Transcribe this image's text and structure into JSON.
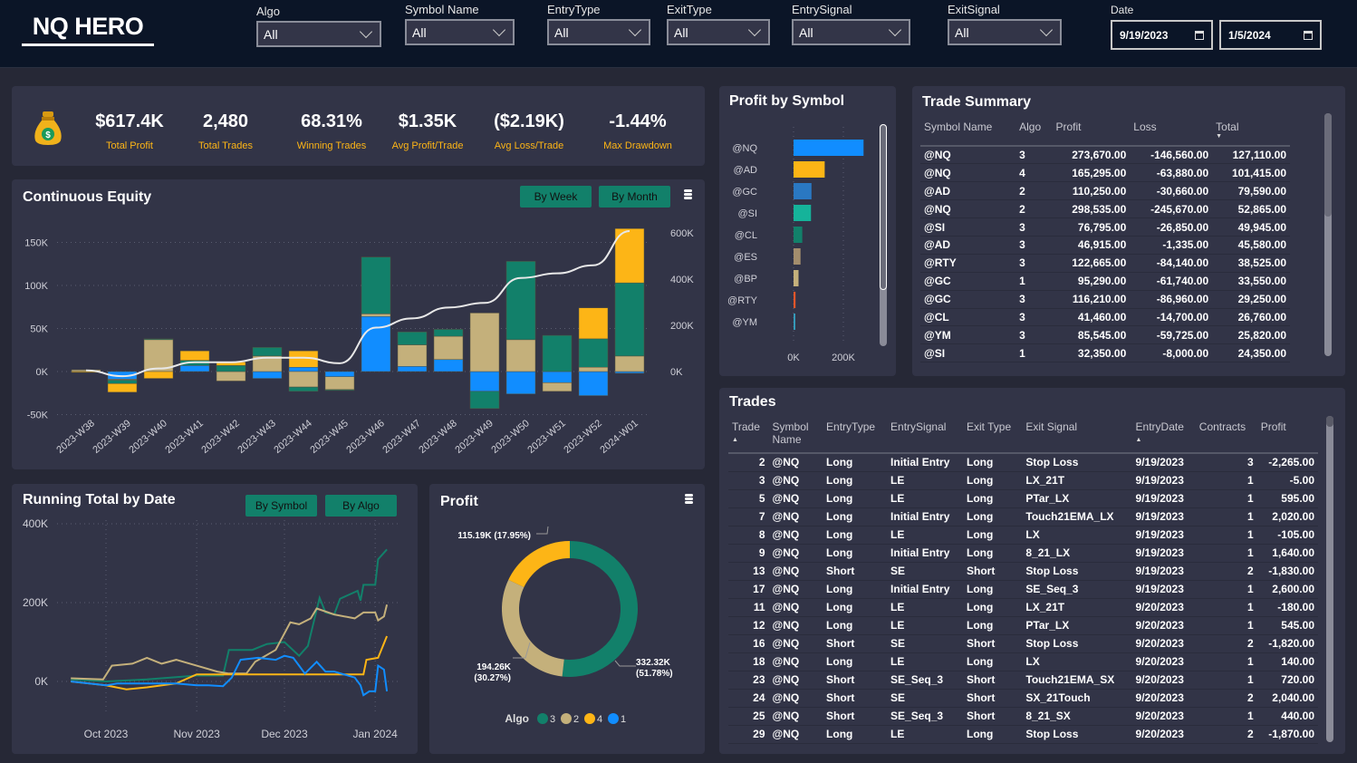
{
  "header": {
    "logo": "NQ HERO",
    "filters": [
      {
        "label": "Algo",
        "value": "All"
      },
      {
        "label": "Symbol Name",
        "value": "All"
      },
      {
        "label": "EntryType",
        "value": "All"
      },
      {
        "label": "ExitType",
        "value": "All"
      },
      {
        "label": "EntrySignal",
        "value": "All"
      },
      {
        "label": "ExitSignal",
        "value": "All"
      }
    ],
    "date": {
      "label": "Date",
      "start": "9/19/2023",
      "end": "1/5/2024"
    }
  },
  "kpis": [
    {
      "value": "$617.4K",
      "label": "Total Profit"
    },
    {
      "value": "2,480",
      "label": "Total Trades"
    },
    {
      "value": "68.31%",
      "label": "Winning Trades"
    },
    {
      "value": "$1.35K",
      "label": "Avg Profit/Trade"
    },
    {
      "value": "($2.19K)",
      "label": "Avg Loss/Trade"
    },
    {
      "value": "-1.44%",
      "label": "Max Drawdown"
    }
  ],
  "colors": {
    "algo1": "#118dff",
    "algo2": "#c4b07b",
    "algo3": "#12806a",
    "algo4": "#fdb516",
    "line": "#e8e8e8"
  },
  "chart_data": [
    {
      "id": "continuous-equity",
      "type": "bar",
      "title": "Continuous Equity",
      "stacked": true,
      "buttons": [
        "By Week",
        "By Month"
      ],
      "categories": [
        "2023-W38",
        "2023-W39",
        "2023-W40",
        "2023-W41",
        "2023-W42",
        "2023-W43",
        "2023-W44",
        "2023-W45",
        "2023-W46",
        "2023-W47",
        "2023-W48",
        "2023-W49",
        "2023-W50",
        "2023-W51",
        "2023-W52",
        "2024-W01"
      ],
      "series": [
        {
          "key": "algo1",
          "values": [
            0,
            -9,
            0,
            7,
            0,
            -8,
            5,
            -6,
            64,
            6,
            14,
            -23,
            -26,
            -13,
            -28,
            -2
          ]
        },
        {
          "key": "algo2",
          "values": [
            2,
            -1,
            37,
            0,
            -11,
            18,
            -18,
            -15,
            3,
            25,
            27,
            68,
            37,
            -10,
            5,
            18
          ]
        },
        {
          "key": "algo3",
          "values": [
            0,
            -4,
            1,
            6,
            7,
            10,
            -5,
            -1,
            66,
            15,
            8,
            -20,
            91,
            42,
            33,
            85
          ]
        },
        {
          "key": "algo4",
          "values": [
            -1,
            -10,
            -8,
            11,
            4,
            0,
            19,
            0,
            0,
            0,
            0,
            0,
            0,
            0,
            36,
            63
          ]
        }
      ],
      "line": {
        "axis": "right",
        "values": [
          5,
          -20,
          13,
          40,
          40,
          60,
          60,
          36,
          190,
          230,
          277,
          297,
          405,
          425,
          460,
          640
        ]
      },
      "ylim": [
        -50,
        150
      ],
      "yticks": [
        "-50K",
        "0K",
        "50K",
        "100K",
        "150K"
      ],
      "y2lim": [
        0,
        600
      ],
      "y2ticks": [
        "0K",
        "200K",
        "400K",
        "600K"
      ],
      "unit": "K"
    },
    {
      "id": "running-total",
      "type": "line",
      "title": "Running Total by Date",
      "buttons": [
        "By Symbol",
        "By Algo"
      ],
      "yticks": [
        "0K",
        "200K",
        "400K"
      ],
      "xticks": [
        "Oct 2023",
        "Nov 2023",
        "Dec 2023",
        "Jan 2024"
      ],
      "series": [
        {
          "key": "algo3",
          "points": [
            [
              "2023-09-19",
              5
            ],
            [
              "2023-10-01",
              0
            ],
            [
              "2023-10-15",
              5
            ],
            [
              "2023-11-01",
              15
            ],
            [
              "2023-11-10",
              15
            ],
            [
              "2023-11-12",
              80
            ],
            [
              "2023-11-20",
              80
            ],
            [
              "2023-11-25",
              95
            ],
            [
              "2023-12-01",
              100
            ],
            [
              "2023-12-06",
              65
            ],
            [
              "2023-12-09",
              90
            ],
            [
              "2023-12-13",
              212
            ],
            [
              "2023-12-15",
              175
            ],
            [
              "2023-12-18",
              170
            ],
            [
              "2023-12-20",
              210
            ],
            [
              "2023-12-26",
              230
            ],
            [
              "2023-12-27",
              205
            ],
            [
              "2023-12-28",
              245
            ],
            [
              "2024-01-01",
              245
            ],
            [
              "2024-01-02",
              310
            ],
            [
              "2024-01-05",
              335
            ]
          ]
        },
        {
          "key": "algo2",
          "points": [
            [
              "2023-09-19",
              8
            ],
            [
              "2023-09-30",
              5
            ],
            [
              "2023-10-03",
              40
            ],
            [
              "2023-10-10",
              45
            ],
            [
              "2023-10-15",
              60
            ],
            [
              "2023-10-20",
              45
            ],
            [
              "2023-10-25",
              55
            ],
            [
              "2023-11-01",
              40
            ],
            [
              "2023-11-08",
              25
            ],
            [
              "2023-11-12",
              20
            ],
            [
              "2023-11-18",
              20
            ],
            [
              "2023-11-21",
              50
            ],
            [
              "2023-11-28",
              80
            ],
            [
              "2023-12-03",
              150
            ],
            [
              "2023-12-06",
              145
            ],
            [
              "2023-12-10",
              160
            ],
            [
              "2023-12-12",
              185
            ],
            [
              "2023-12-18",
              170
            ],
            [
              "2023-12-25",
              160
            ],
            [
              "2023-12-28",
              175
            ],
            [
              "2024-01-01",
              175
            ],
            [
              "2024-01-02",
              155
            ],
            [
              "2024-01-04",
              165
            ],
            [
              "2024-01-05",
              195
            ]
          ]
        },
        {
          "key": "algo4",
          "points": [
            [
              "2023-09-19",
              0
            ],
            [
              "2023-10-01",
              -10
            ],
            [
              "2023-10-08",
              -20
            ],
            [
              "2023-10-15",
              -15
            ],
            [
              "2023-10-25",
              -5
            ],
            [
              "2023-11-01",
              18
            ],
            [
              "2023-12-28",
              18
            ],
            [
              "2023-12-29",
              55
            ],
            [
              "2024-01-02",
              60
            ],
            [
              "2024-01-05",
              115
            ]
          ]
        },
        {
          "key": "algo1",
          "points": [
            [
              "2023-09-19",
              0
            ],
            [
              "2023-10-01",
              -10
            ],
            [
              "2023-10-05",
              -5
            ],
            [
              "2023-10-15",
              -5
            ],
            [
              "2023-10-25",
              -5
            ],
            [
              "2023-11-01",
              -10
            ],
            [
              "2023-11-05",
              -10
            ],
            [
              "2023-11-10",
              -12
            ],
            [
              "2023-11-13",
              10
            ],
            [
              "2023-11-16",
              55
            ],
            [
              "2023-11-22",
              60
            ],
            [
              "2023-11-28",
              55
            ],
            [
              "2023-12-01",
              65
            ],
            [
              "2023-12-04",
              60
            ],
            [
              "2023-12-06",
              40
            ],
            [
              "2023-12-08",
              20
            ],
            [
              "2023-12-12",
              50
            ],
            [
              "2023-12-15",
              25
            ],
            [
              "2023-12-18",
              25
            ],
            [
              "2023-12-25",
              10
            ],
            [
              "2023-12-27",
              -10
            ],
            [
              "2023-12-28",
              -35
            ],
            [
              "2023-12-30",
              -25
            ],
            [
              "2024-01-01",
              -25
            ],
            [
              "2024-01-02",
              40
            ],
            [
              "2024-01-04",
              30
            ],
            [
              "2024-01-05",
              -25
            ]
          ]
        }
      ]
    },
    {
      "id": "profit-donut",
      "type": "pie",
      "title": "Profit",
      "legend_title": "Algo",
      "slices": [
        {
          "label": "3",
          "value": 332.32,
          "key": "algo3",
          "text": [
            "332.32K",
            "(51.78%)"
          ]
        },
        {
          "label": "2",
          "value": 194.26,
          "key": "algo2",
          "text": [
            "194.26K",
            "(30.27%)"
          ]
        },
        {
          "label": "4",
          "value": 115.19,
          "key": "algo4",
          "text": [
            "115.19K (17.95%)"
          ]
        }
      ],
      "legend": [
        {
          "label": "3",
          "key": "algo3"
        },
        {
          "label": "2",
          "key": "algo2"
        },
        {
          "label": "4",
          "key": "algo4"
        },
        {
          "label": "1",
          "key": "algo1"
        }
      ]
    },
    {
      "id": "profit-by-symbol",
      "type": "bar",
      "orientation": "horizontal",
      "title": "Profit by Symbol",
      "categories": [
        "@NQ",
        "@AD",
        "@GC",
        "@SI",
        "@CL",
        "@ES",
        "@BP",
        "@RTY",
        "@YM"
      ],
      "values": [
        281,
        125,
        72,
        70,
        35,
        28,
        20,
        8,
        6
      ],
      "colors": [
        "#118dff",
        "#fdb516",
        "#2a78c2",
        "#15b39a",
        "#12806a",
        "#a38d6d",
        "#c4b07b",
        "#e8562a",
        "#3599b8"
      ],
      "xticks": [
        "0K",
        "200K"
      ]
    }
  ],
  "trade_summary": {
    "title": "Trade Summary",
    "columns": [
      "Symbol Name",
      "Algo",
      "Profit",
      "Loss",
      "Total"
    ],
    "rows": [
      [
        "@NQ",
        "3",
        "273,670.00",
        "-146,560.00",
        "127,110.00"
      ],
      [
        "@NQ",
        "4",
        "165,295.00",
        "-63,880.00",
        "101,415.00"
      ],
      [
        "@AD",
        "2",
        "110,250.00",
        "-30,660.00",
        "79,590.00"
      ],
      [
        "@NQ",
        "2",
        "298,535.00",
        "-245,670.00",
        "52,865.00"
      ],
      [
        "@SI",
        "3",
        "76,795.00",
        "-26,850.00",
        "49,945.00"
      ],
      [
        "@AD",
        "3",
        "46,915.00",
        "-1,335.00",
        "45,580.00"
      ],
      [
        "@RTY",
        "3",
        "122,665.00",
        "-84,140.00",
        "38,525.00"
      ],
      [
        "@GC",
        "1",
        "95,290.00",
        "-61,740.00",
        "33,550.00"
      ],
      [
        "@GC",
        "3",
        "116,210.00",
        "-86,960.00",
        "29,250.00"
      ],
      [
        "@CL",
        "3",
        "41,460.00",
        "-14,700.00",
        "26,760.00"
      ],
      [
        "@YM",
        "3",
        "85,545.00",
        "-59,725.00",
        "25,820.00"
      ],
      [
        "@SI",
        "1",
        "32,350.00",
        "-8,000.00",
        "24,350.00"
      ]
    ]
  },
  "trades": {
    "title": "Trades",
    "columns": [
      "Trade",
      "Symbol Name",
      "EntryType",
      "EntrySignal",
      "Exit Type",
      "Exit Signal",
      "EntryDate",
      "Contracts",
      "Profit"
    ],
    "rows": [
      [
        "2",
        "@NQ",
        "Long",
        "Initial Entry",
        "Long",
        "Stop Loss",
        "9/19/2023",
        "3",
        "-2,265.00"
      ],
      [
        "3",
        "@NQ",
        "Long",
        "LE",
        "Long",
        "LX_21T",
        "9/19/2023",
        "1",
        "-5.00"
      ],
      [
        "5",
        "@NQ",
        "Long",
        "LE",
        "Long",
        "PTar_LX",
        "9/19/2023",
        "1",
        "595.00"
      ],
      [
        "7",
        "@NQ",
        "Long",
        "Initial Entry",
        "Long",
        "Touch21EMA_LX",
        "9/19/2023",
        "1",
        "2,020.00"
      ],
      [
        "8",
        "@NQ",
        "Long",
        "LE",
        "Long",
        "LX",
        "9/19/2023",
        "1",
        "-105.00"
      ],
      [
        "9",
        "@NQ",
        "Long",
        "Initial Entry",
        "Long",
        "8_21_LX",
        "9/19/2023",
        "1",
        "1,640.00"
      ],
      [
        "13",
        "@NQ",
        "Short",
        "SE",
        "Short",
        "Stop Loss",
        "9/19/2023",
        "2",
        "-1,830.00"
      ],
      [
        "17",
        "@NQ",
        "Long",
        "Initial Entry",
        "Long",
        "SE_Seq_3",
        "9/19/2023",
        "1",
        "2,600.00"
      ],
      [
        "11",
        "@NQ",
        "Long",
        "LE",
        "Long",
        "LX_21T",
        "9/20/2023",
        "1",
        "-180.00"
      ],
      [
        "12",
        "@NQ",
        "Long",
        "LE",
        "Long",
        "PTar_LX",
        "9/20/2023",
        "1",
        "545.00"
      ],
      [
        "16",
        "@NQ",
        "Short",
        "SE",
        "Short",
        "Stop Loss",
        "9/20/2023",
        "2",
        "-1,820.00"
      ],
      [
        "18",
        "@NQ",
        "Long",
        "LE",
        "Long",
        "LX",
        "9/20/2023",
        "1",
        "140.00"
      ],
      [
        "23",
        "@NQ",
        "Short",
        "SE_Seq_3",
        "Short",
        "Touch21EMA_SX",
        "9/20/2023",
        "1",
        "720.00"
      ],
      [
        "24",
        "@NQ",
        "Short",
        "SE",
        "Short",
        "SX_21Touch",
        "9/20/2023",
        "2",
        "2,040.00"
      ],
      [
        "25",
        "@NQ",
        "Short",
        "SE_Seq_3",
        "Short",
        "8_21_SX",
        "9/20/2023",
        "1",
        "440.00"
      ],
      [
        "29",
        "@NQ",
        "Long",
        "LE",
        "Long",
        "Stop Loss",
        "9/20/2023",
        "2",
        "-1,870.00"
      ]
    ]
  }
}
